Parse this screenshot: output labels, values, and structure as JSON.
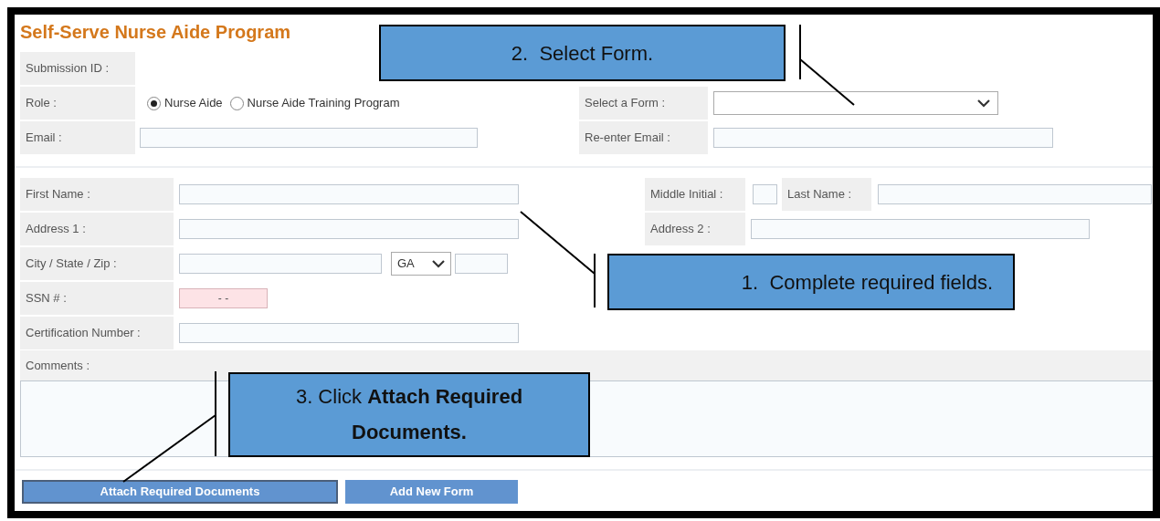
{
  "title": "Self-Serve Nurse Aide Program",
  "submission_id": {
    "label": "Submission ID :"
  },
  "role": {
    "label": "Role :",
    "options": [
      {
        "label": "Nurse Aide",
        "selected": true
      },
      {
        "label": "Nurse Aide Training Program",
        "selected": false
      }
    ]
  },
  "email": {
    "label": "Email :"
  },
  "select_form": {
    "label": "Select a Form :"
  },
  "reenter_email": {
    "label": "Re-enter Email :"
  },
  "first_name": {
    "label": "First Name :"
  },
  "middle_initial": {
    "label": "Middle Initial :"
  },
  "last_name": {
    "label": "Last Name :"
  },
  "address_1": {
    "label": "Address 1 :"
  },
  "address_2": {
    "label": "Address 2 :"
  },
  "city_state_zip": {
    "label": "City / State / Zip :",
    "state": "GA"
  },
  "ssn": {
    "label": "SSN # :",
    "value": "- -"
  },
  "certification_number": {
    "label": "Certification Number :"
  },
  "comments": {
    "label": "Comments :"
  },
  "buttons": [
    {
      "label": "Attach Required Documents",
      "kind": "outlined"
    },
    {
      "label": "Add New Form",
      "kind": "plain"
    }
  ],
  "callouts": [
    {
      "text": "2.  Select Form."
    },
    {
      "text": "1.  Complete required fields."
    },
    {
      "text": "3. Click **Attach Required Documents.**"
    }
  ]
}
